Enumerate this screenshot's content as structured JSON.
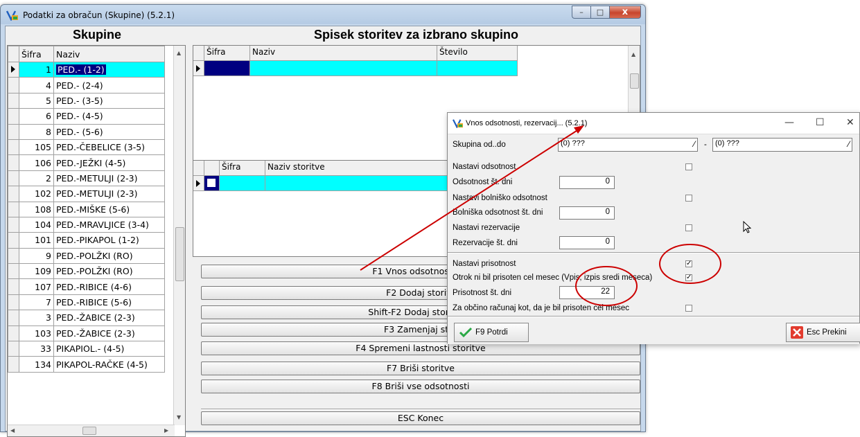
{
  "window": {
    "title": "Podatki za obračun (Skupine)  (5.2.1)",
    "min_glyph": "–",
    "max_glyph": "□",
    "close_glyph": "x"
  },
  "left_panel": {
    "header": "Skupine",
    "columns": [
      "Šifra",
      "Naziv"
    ],
    "rows": [
      {
        "code": "1",
        "name": "PED.- (1-2)"
      },
      {
        "code": "4",
        "name": "PED.- (2-4)"
      },
      {
        "code": "5",
        "name": "PED.- (3-5)"
      },
      {
        "code": "6",
        "name": "PED.- (4-5)"
      },
      {
        "code": "8",
        "name": "PED.- (5-6)"
      },
      {
        "code": "105",
        "name": "PED.-ČEBELICE (3-5)"
      },
      {
        "code": "106",
        "name": "PED.-JEŽKI (4-5)"
      },
      {
        "code": "2",
        "name": "PED.-METULJI (2-3)"
      },
      {
        "code": "102",
        "name": "PED.-METULJI (2-3)"
      },
      {
        "code": "108",
        "name": "PED.-MIŠKE (5-6)"
      },
      {
        "code": "104",
        "name": "PED.-MRAVLJICE (3-4)"
      },
      {
        "code": "101",
        "name": "PED.-PIKAPOL (1-2)"
      },
      {
        "code": "9",
        "name": "PED.-POLŽKI (RO)"
      },
      {
        "code": "109",
        "name": "PED.-POLŽKI (RO)"
      },
      {
        "code": "107",
        "name": "PED.-RIBICE (4-6)"
      },
      {
        "code": "7",
        "name": "PED.-RIBICE (5-6)"
      },
      {
        "code": "3",
        "name": "PED.-ŽABICE (2-3)"
      },
      {
        "code": "103",
        "name": "PED.-ŽABICE (2-3)"
      },
      {
        "code": "33",
        "name": "PIKAPIOL.- (4-5)"
      },
      {
        "code": "134",
        "name": "PIKAPOL-RAČKE (4-5)"
      }
    ]
  },
  "right_panel": {
    "header": "Spisek storitev za izbrano skupino",
    "grid1_columns": [
      "Šifra",
      "Naziv",
      "Število"
    ],
    "grid2_columns": [
      "Šifra",
      "Naziv storitve"
    ]
  },
  "buttons": [
    {
      "label": "F1 Vnos odsotnosti, re"
    },
    {
      "label": "F2 Dodaj storite"
    },
    {
      "label": "Shift-F2 Dodaj storitev v"
    },
    {
      "label": "F3 Zamenjaj stor"
    },
    {
      "label": "F4 Spremeni lastnosti storitve"
    },
    {
      "label": "F7 Briši storitve"
    },
    {
      "label": "F8 Briši vse odsotnosti"
    },
    {
      "label": "ESC Konec"
    }
  ],
  "dialog": {
    "title": "Vnos odsotnosti, rezervacij...  (5.2.1)",
    "min_glyph": "—",
    "max_glyph": "☐",
    "close_glyph": "✕",
    "group_label": "Skupina od..do",
    "group_from": "(0) ???",
    "dash": "-",
    "group_to": "(0) ???",
    "dropdown_glyph": "⁄",
    "fields": {
      "absence_set": "Nastavi odsotnost",
      "absence_days": "Odsotnost št. dni",
      "absence_days_value": "0",
      "sick_set": "Nastavi bolniško odsotnost",
      "sick_days": "Bolniška odsotnost št. dni",
      "sick_days_value": "0",
      "reserv_set": "Nastavi rezervacije",
      "reserv_days": "Rezervacije št. dni",
      "reserv_days_value": "0",
      "presence_set": "Nastavi prisotnost",
      "not_present": "Otrok ni bil prisoten cel mesec (Vpis,  izpis sredi meseca)",
      "presence_days": "Prisotnost št. dni",
      "presence_days_value": "22",
      "municipality": "Za občino računaj kot, da je bil prisoten cel mesec"
    },
    "check_mark": "✓",
    "confirm_label": "F9 Potrdi",
    "cancel_label": "Esc Prekini"
  },
  "colors": {
    "selection": "#00ffff",
    "highlight": "#000080",
    "annotation": "#cc0000"
  }
}
